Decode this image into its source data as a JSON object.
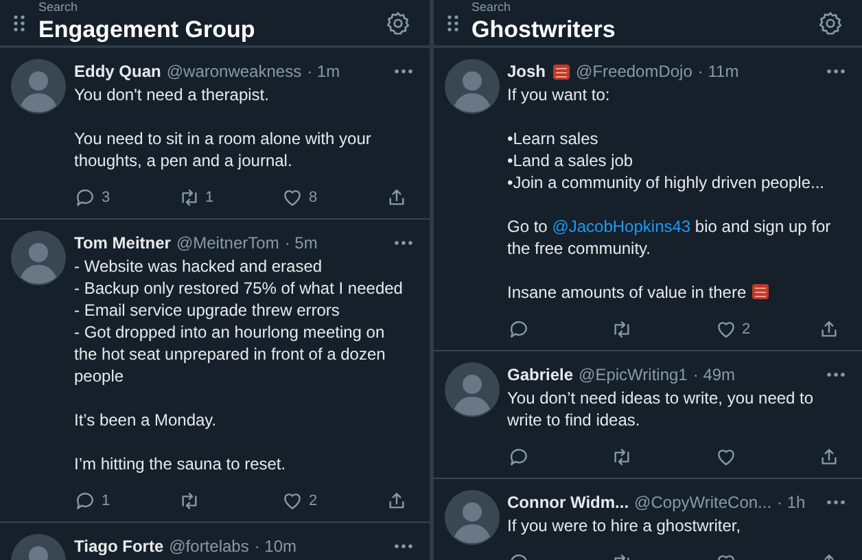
{
  "columns": [
    {
      "label": "Search",
      "title": "Engagement Group",
      "tweets": [
        {
          "name": "Eddy Quan",
          "handle": "@waronweakness",
          "time": "· 1m",
          "paragraphs": [
            [
              "You don't need a therapist."
            ],
            [
              "You need to sit in a room alone with your",
              "thoughts, a pen and a journal."
            ]
          ],
          "replies": "3",
          "retweets": "1",
          "likes": "8"
        },
        {
          "name": "Tom Meitner",
          "handle": "@MeitnerTom",
          "time": "· 5m",
          "paragraphs": [
            [
              "- Website was hacked and erased",
              "- Backup only restored 75% of what I needed",
              "- Email service upgrade threw errors",
              "- Got dropped into an hourlong meeting on",
              "the hot seat unprepared in front of a dozen",
              "people"
            ],
            [
              "It’s been a Monday."
            ],
            [
              "I’m hitting the sauna to reset."
            ]
          ],
          "replies": "1",
          "likes": "2"
        },
        {
          "name": "Tiago Forte",
          "handle": "@fortelabs",
          "time": "· 10m"
        }
      ]
    },
    {
      "label": "Search",
      "title": "Ghostwriters",
      "tweets": [
        {
          "name": "Josh",
          "name_emoji": true,
          "handle": "@FreedomDojo",
          "time": "· 11m",
          "paragraphs": [
            [
              "If you want to:"
            ],
            [
              "•Learn sales",
              "•Land a sales job",
              "•Join a community of highly driven people..."
            ],
            [
              [
                {
                  "kind": "text",
                  "text": "Go to "
                },
                {
                  "kind": "mention",
                  "text": "@JacobHopkins43"
                },
                {
                  "kind": "text",
                  "text": " bio and sign up for"
                }
              ],
              "the free community."
            ],
            [
              "Insane amounts of value in there"
            ]
          ],
          "trailing_emoji": true,
          "likes": "2"
        },
        {
          "name": "Gabriele",
          "handle": "@EpicWriting1",
          "time": "· 49m",
          "paragraphs": [
            [
              "You don’t need ideas to write, you need to",
              "write to find ideas."
            ]
          ]
        },
        {
          "name": "Connor Widm...",
          "handle": "@CopyWriteCon...",
          "time": "· 1h",
          "paragraphs": [
            [
              "If you were to hire a ghostwriter,"
            ]
          ]
        }
      ]
    }
  ]
}
